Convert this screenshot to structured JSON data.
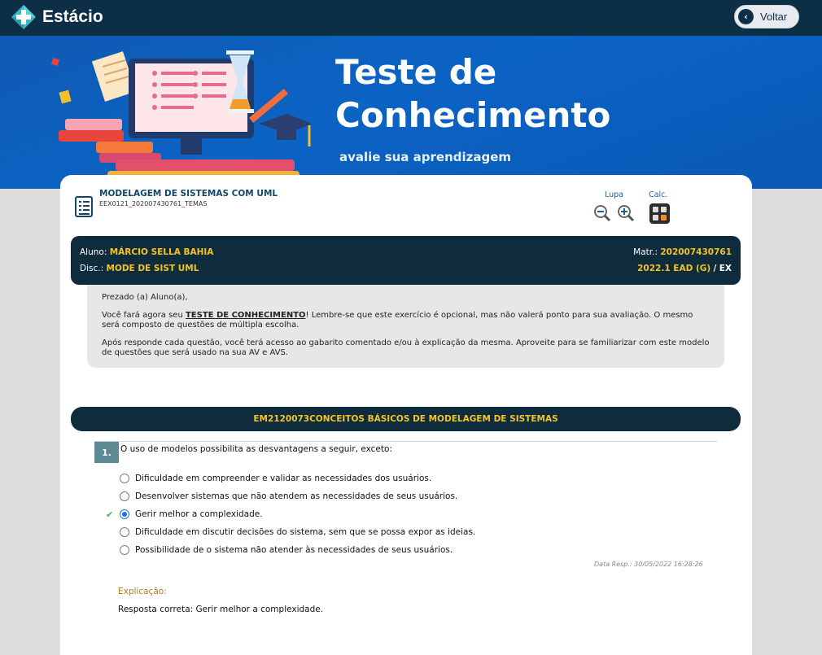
{
  "header": {
    "brand": "Estácio",
    "back_label": "Voltar"
  },
  "hero": {
    "title_line1": "Teste de",
    "title_line2": "Conhecimento",
    "subtitle": "avalie sua aprendizagem"
  },
  "course": {
    "title": "MODELAGEM DE SISTEMAS COM UML",
    "code": "EEX0121_202007430761_TEMAS"
  },
  "tools": {
    "lupa_label": "Lupa",
    "calc_label": "Calc."
  },
  "student": {
    "aluno_label": "Aluno:",
    "aluno_name": "MÁRCIO SELLA BAHIA",
    "disc_label": "Disc.:",
    "disc_name": "MODE DE SIST UML",
    "matr_label": "Matr.:",
    "matr_value": "202007430761",
    "period": "2022.1 EAD (G)",
    "sep": "/",
    "type": "EX"
  },
  "notice": {
    "greeting": "Prezado (a) Aluno(a),",
    "p1_before": "Você fará agora seu ",
    "p1_keyword": "TESTE DE CONHECIMENTO",
    "p1_after": "! Lembre-se que este exercício é opcional, mas não valerá ponto para sua avaliação. O mesmo será composto de questões de múltipla escolha.",
    "p2": "Após responde cada questão, você terá acesso ao gabarito comentado e/ou à explicação da mesma. Aproveite para se familiarizar com este modelo de questões que será usado na sua AV e AVS."
  },
  "section": {
    "title": "EM2120073CONCEITOS BÁSICOS DE MODELAGEM DE SISTEMAS"
  },
  "question": {
    "number": "1.",
    "text": "O uso de modelos possibilita as desvantagens a seguir, exceto:",
    "options": [
      {
        "text": "Dificuldade em compreender e validar as necessidades dos usuários.",
        "selected": false,
        "correct": false
      },
      {
        "text": "Desenvolver sistemas que não atendem as necessidades de seus usuários.",
        "selected": false,
        "correct": false
      },
      {
        "text": "Gerir melhor a complexidade.",
        "selected": true,
        "correct": true
      },
      {
        "text": "Dificuldade em discutir decisões do sistema, sem que se possa expor as ideias.",
        "selected": false,
        "correct": false
      },
      {
        "text": "Possibilidade de o sistema não atender às necessidades de seus usuários.",
        "selected": false,
        "correct": false
      }
    ],
    "data_resp": "Data Resp.: 30/05/2022 16:28:26",
    "explanation_label": "Explicação:",
    "explanation_text": "Resposta correta: Gerir melhor a complexidade."
  },
  "icons": {
    "logo": "estacio-logo-icon",
    "back": "chevron-left-icon",
    "course": "document-list-icon",
    "zoom_out": "zoom-out-icon",
    "zoom_in": "zoom-in-icon",
    "calculator": "calculator-icon",
    "correct": "checkmark-icon"
  },
  "colors": {
    "topbar": "#0d2f45",
    "hero": "#0b63c4",
    "dark_bar": "#0e2c3c",
    "accent_yellow": "#f5c424",
    "question_number_bg": "#5d8a92",
    "explanation_label": "#b5781e",
    "selected_radio": "#1f6fe0",
    "correct_check": "#4caf50"
  }
}
